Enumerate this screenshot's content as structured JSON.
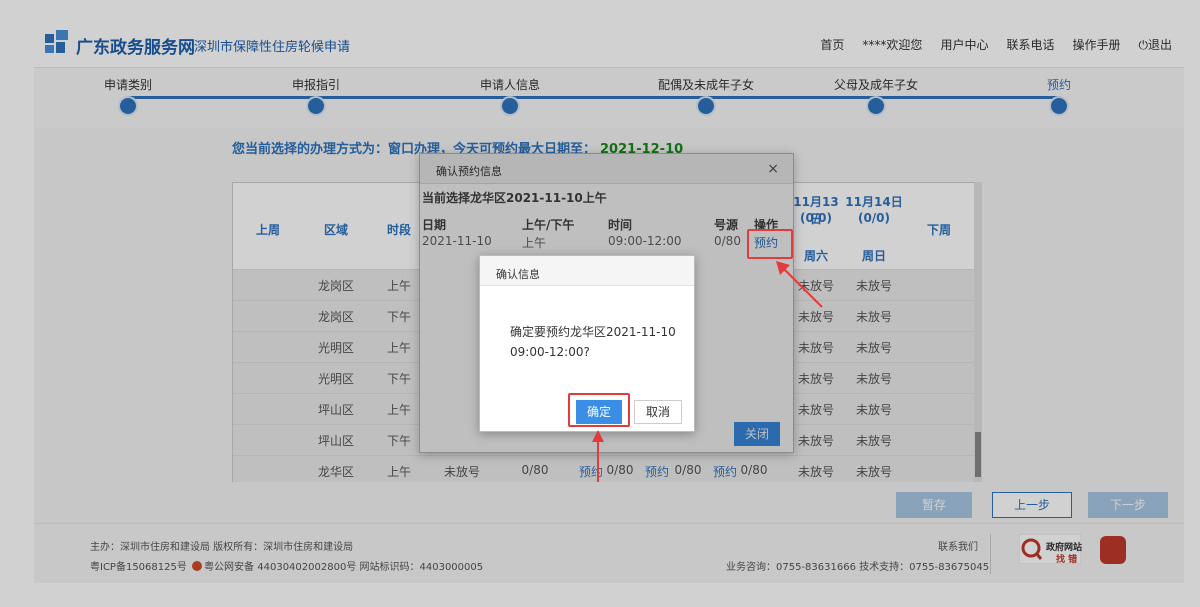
{
  "header": {
    "site_name": "广东政务服务网",
    "site_sub": "深圳市保障性住房轮候申请",
    "nav": [
      "首页",
      "****欢迎您",
      "用户中心",
      "联系电话",
      "操作手册",
      "退出"
    ],
    "logout_icon": "power-icon"
  },
  "steps": [
    {
      "label": "申请类别"
    },
    {
      "label": "申报指引"
    },
    {
      "label": "申请人信息"
    },
    {
      "label": "配偶及未成年子女"
    },
    {
      "label": "父母及成年子女"
    },
    {
      "label": "预约",
      "active": true
    }
  ],
  "notice": {
    "text": "您当前选择的办理方式为：窗口办理，今天可预约最大日期至：",
    "date": "2021-12-10"
  },
  "table": {
    "prev_week": "上周",
    "col_region": "区域",
    "col_period": "时段",
    "next_week": "下周",
    "day_cols": [
      {
        "date": "11月13日",
        "count": "(0/0)",
        "weekday": "周六"
      },
      {
        "date": "11月14日",
        "count": "(0/0)",
        "weekday": "周日"
      }
    ],
    "rows": [
      {
        "region": "龙岗区",
        "period": "上午",
        "d13": "未放号",
        "d14": "未放号"
      },
      {
        "region": "龙岗区",
        "period": "下午",
        "d13": "未放号",
        "d14": "未放号"
      },
      {
        "region": "光明区",
        "period": "上午",
        "d13": "未放号",
        "d14": "未放号"
      },
      {
        "region": "光明区",
        "period": "下午",
        "d13": "未放号",
        "d14": "未放号"
      },
      {
        "region": "坪山区",
        "period": "上午",
        "d13": "未放号",
        "d14": "未放号"
      },
      {
        "region": "坪山区",
        "period": "下午",
        "d13": "未放号",
        "d14": "未放号"
      },
      {
        "region": "龙华区",
        "period": "上午",
        "c1": "未放号",
        "c2": "0/80",
        "c3": "预约",
        "c4": "0/80",
        "c5": "预约",
        "c6": "0/80",
        "c7": "预约",
        "c8": "0/80",
        "d13": "未放号",
        "d14": "未放号"
      }
    ]
  },
  "buttons": {
    "save": "暂存",
    "prev": "上一步",
    "next": "下一步"
  },
  "booking_dialog": {
    "title": "确认预约信息",
    "close_symbol": "×",
    "subtitle": "当前选择龙华区2021-11-10上午",
    "headers": [
      "日期",
      "上午/下午",
      "时间",
      "号源",
      "操作"
    ],
    "row": [
      "2021-11-10",
      "上午",
      "09:00-12:00",
      "0/80",
      "预约"
    ],
    "close_button": "关闭"
  },
  "confirm_dialog": {
    "title": "确认信息",
    "message": "确定要预约龙华区2021-11-10 09:00-12:00?",
    "ok": "确定",
    "cancel": "取消"
  },
  "footer": {
    "line1": "主办：深圳市住房和建设局 版权所有：深圳市住房和建设局",
    "line2_a": "粤ICP备15068125号",
    "line2_b": "粤公网安备 44030402002800号 网站标识码：4403000005",
    "contact": "联系我们",
    "hotline": "业务咨询：0755-83631666 技术支持：0755-83675045",
    "gov_badge_line1": "政府网站",
    "gov_badge_line2": "找 错"
  },
  "colors": {
    "primary": "#2e73bd",
    "accent_red": "#e23b3b",
    "date_green": "#1a8a1a"
  }
}
